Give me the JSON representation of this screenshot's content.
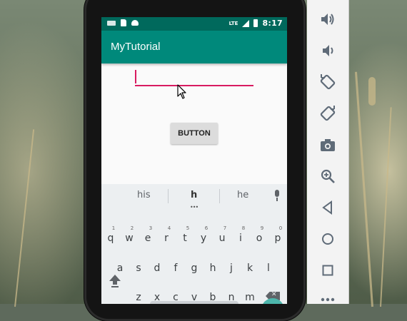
{
  "status_bar": {
    "network": "LTE",
    "time": "8:17"
  },
  "app_bar": {
    "title": "MyTutorial"
  },
  "form": {
    "edit_text_value": "",
    "button_label": "BUTTON"
  },
  "keyboard": {
    "suggestions": [
      "his",
      "h",
      "he"
    ],
    "row1": [
      {
        "key": "q",
        "hint": "1"
      },
      {
        "key": "w",
        "hint": "2"
      },
      {
        "key": "e",
        "hint": "3"
      },
      {
        "key": "r",
        "hint": "4"
      },
      {
        "key": "t",
        "hint": "5"
      },
      {
        "key": "y",
        "hint": "6"
      },
      {
        "key": "u",
        "hint": "7"
      },
      {
        "key": "i",
        "hint": "8"
      },
      {
        "key": "o",
        "hint": "9"
      },
      {
        "key": "p",
        "hint": "0"
      }
    ],
    "row2": [
      "a",
      "s",
      "d",
      "f",
      "g",
      "h",
      "j",
      "k",
      "l"
    ],
    "row3": [
      "z",
      "x",
      "c",
      "v",
      "b",
      "n",
      "m"
    ]
  },
  "emulator_toolbar": {
    "tools": [
      "volume-up-icon",
      "volume-down-icon",
      "rotate-left-icon",
      "rotate-right-icon",
      "camera-icon",
      "zoom-icon",
      "back-icon",
      "home-icon",
      "overview-icon",
      "more-icon"
    ],
    "icon_color": "#5f6b78"
  },
  "colors": {
    "status_bar": "#00695c",
    "app_bar": "#00897b",
    "accent": "#d81b60"
  }
}
